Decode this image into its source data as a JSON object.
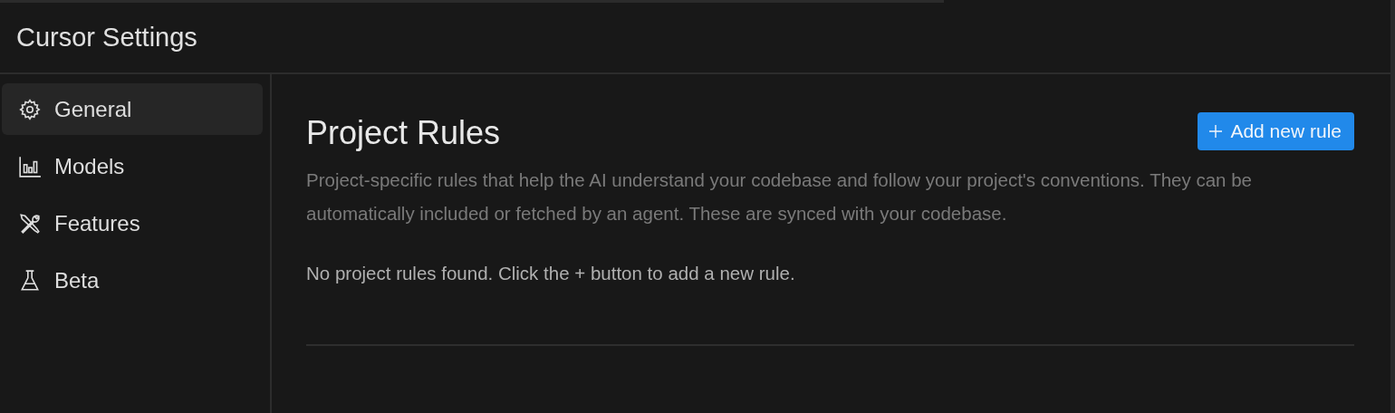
{
  "window": {
    "title": "Cursor Settings"
  },
  "sidebar": {
    "items": [
      {
        "kind": "gear",
        "label": "General",
        "selected": true
      },
      {
        "kind": "chart",
        "label": "Models",
        "selected": false
      },
      {
        "kind": "tools",
        "label": "Features",
        "selected": false
      },
      {
        "kind": "flask",
        "label": "Beta",
        "selected": false
      }
    ]
  },
  "section": {
    "title": "Project Rules",
    "button": "Add new rule",
    "description": "Project-specific rules that help the AI understand your codebase and follow your project's conventions. They can be automatically included or fetched by an agent. These are synced with your codebase.",
    "empty_message": "No project rules found. Click the + button to add a new rule."
  }
}
